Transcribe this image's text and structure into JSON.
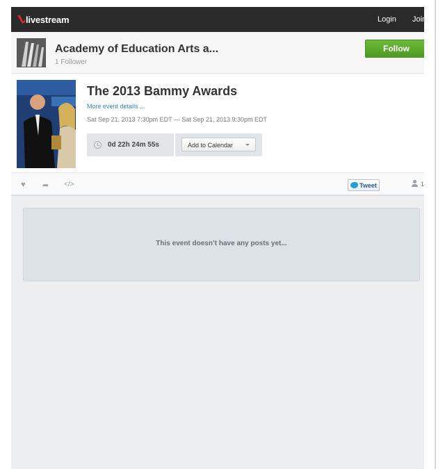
{
  "nav": {
    "logo_text": "livestream",
    "login_label": "Login",
    "join_label": "Join"
  },
  "channel": {
    "title": "Academy of Education Arts a...",
    "followers": "1 Follower",
    "follow_label": "Follow"
  },
  "event": {
    "title": "The 2013 Bammy Awards",
    "details_link": "More event details ...",
    "dates": "Sat Sep 21, 2013 7:30pm EDT — Sat Sep 21, 2013 9:30pm EDT",
    "countdown": "0d 22h 24m 55s",
    "calendar_label": "Add to Calendar"
  },
  "actions": {
    "tweet_label": "Tweet",
    "viewer_count": "1",
    "icons": [
      "heart-icon",
      "share-icon",
      "embed-icon",
      "twitter-icon",
      "user-icon"
    ]
  },
  "posts": {
    "empty_text": "This event doesn’t have any posts yet..."
  },
  "colors": {
    "topbar": "#2b2b2b",
    "follow_button": "#5aa82c",
    "link": "#3b84c6",
    "logo_accent": "#e0282e"
  }
}
